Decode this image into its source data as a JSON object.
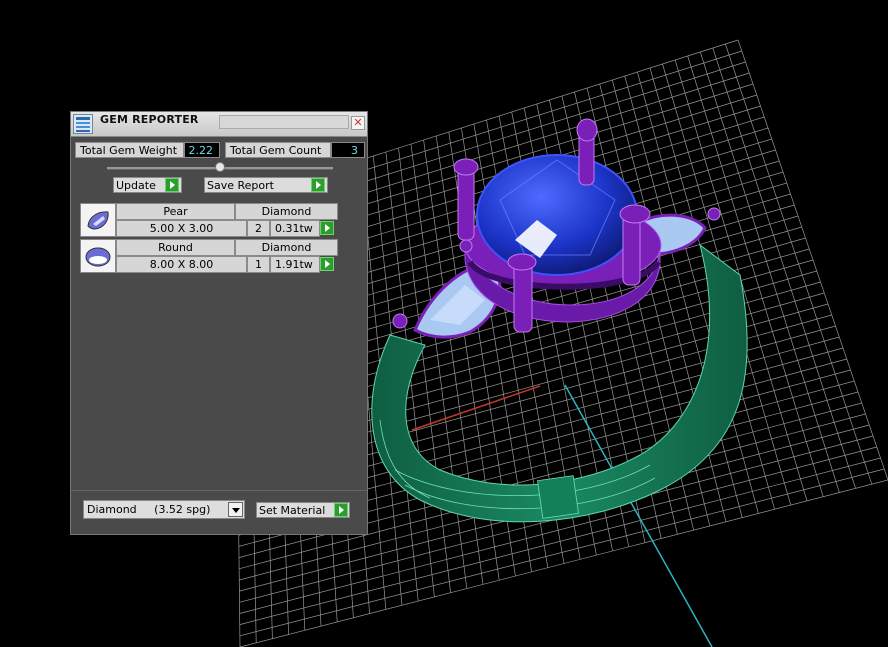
{
  "panel": {
    "title": "GEM REPORTER",
    "totals": {
      "weight_label": "Total Gem Weight",
      "weight_value": "2.22",
      "count_label": "Total Gem Count",
      "count_value": "3"
    },
    "buttons": {
      "update": "Update",
      "save_report": "Save Report",
      "set_material": "Set Material"
    },
    "gems": [
      {
        "shape": "Pear",
        "material": "Diamond",
        "size": "5.00 X 3.00",
        "qty": "2",
        "weight": "0.31tw",
        "icon": "pear-gem-icon"
      },
      {
        "shape": "Round",
        "material": "Diamond",
        "size": "8.00 X 8.00",
        "qty": "1",
        "weight": "1.91tw",
        "icon": "round-gem-icon"
      }
    ],
    "material_select": {
      "value": "Diamond     (3.52 spg)"
    }
  },
  "viewport": {
    "scene": "ring-render",
    "colors": {
      "background": "#000000",
      "grid": "#bdbdbd",
      "band": "#137a55",
      "prongs": "#7a1fb8",
      "center_stone": "#1c3fd0",
      "side_stones": "#a9c8f2",
      "x_axis": "#c0392b",
      "y_axis": "#2bb5c0"
    }
  }
}
